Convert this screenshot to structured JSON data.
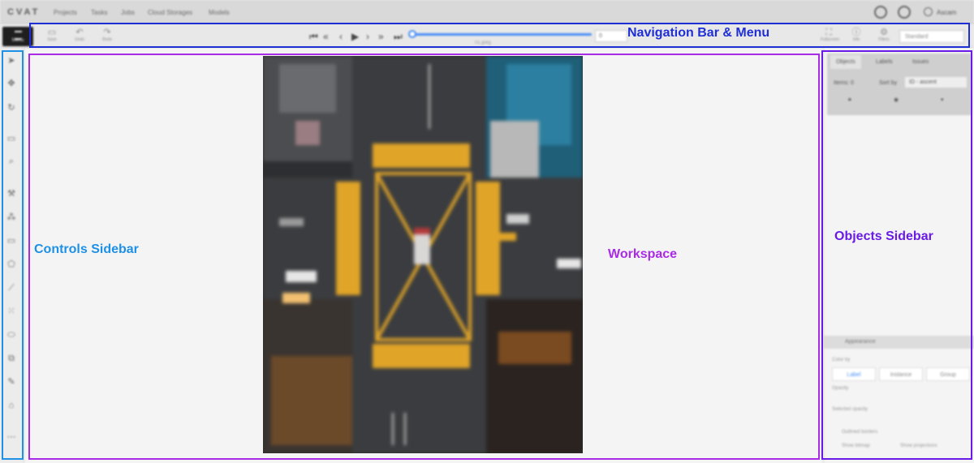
{
  "app": {
    "logo": "CVAT",
    "nav": [
      "Projects",
      "Tasks",
      "Jobs",
      "Cloud Storages",
      "Models"
    ],
    "user": "Ascam"
  },
  "toolbar": {
    "menu_label": "Menu",
    "save_label": "Save",
    "undo_label": "Undo",
    "redo_label": "Redo",
    "frame_value": "0",
    "filename": "01.jpeg",
    "fullscreen_label": "Fullscreen",
    "info_label": "Info",
    "filters_label": "Filters",
    "workspace_value": "Standard"
  },
  "objects_sidebar": {
    "tabs": [
      "Objects",
      "Labels",
      "Issues"
    ],
    "items_label": "Items: 0",
    "sort_label": "Sort by",
    "sort_value": "ID - ascent",
    "appearance_title": "Appearance",
    "color_by_label": "Color by",
    "color_options": [
      "Label",
      "Instance",
      "Group"
    ],
    "opacity_label": "Opacity",
    "selected_opacity_label": "Selected opacity",
    "outlined_label": "Outlined borders",
    "show_bitmap_label": "Show bitmap",
    "show_projections_label": "Show projections"
  },
  "annotations": {
    "navigation": "Navigation Bar & Menu",
    "controls": "Controls Sidebar",
    "workspace": "Workspace",
    "objects": "Objects Sidebar"
  },
  "colors": {
    "navigation": "#1f2fd6",
    "controls": "#1e90e6",
    "workspace": "#a92be6",
    "objects": "#6a1ae6",
    "slider": "#4a8ff7"
  },
  "icons": [
    "github-icon",
    "help-icon",
    "user-icon",
    "cursor-icon",
    "move-icon",
    "rotate-icon",
    "fit-icon",
    "zoom-icon",
    "magic-wand-icon",
    "opencv-icon",
    "rectangle-icon",
    "polygon-icon",
    "polyline-icon",
    "points-icon",
    "ellipse-icon",
    "cuboid-icon",
    "brush-icon",
    "tag-icon"
  ]
}
